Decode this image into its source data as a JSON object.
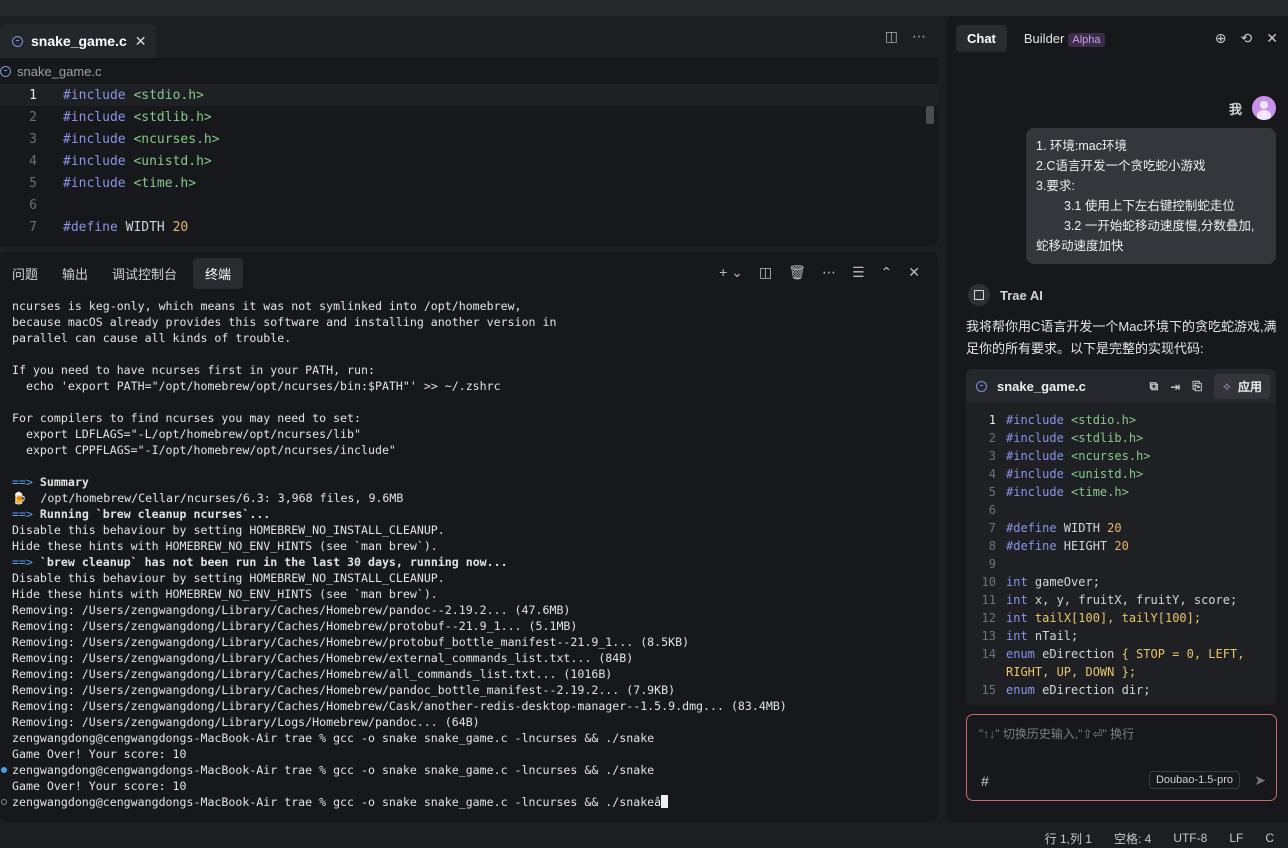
{
  "editor": {
    "tab_label": "snake_game.c",
    "breadcrumb": "snake_game.c",
    "lines": [
      {
        "n": "1",
        "pre": "#include",
        "arg": "<stdio.h>",
        "type": "include"
      },
      {
        "n": "2",
        "pre": "#include",
        "arg": "<stdlib.h>",
        "type": "include"
      },
      {
        "n": "3",
        "pre": "#include",
        "arg": "<ncurses.h>",
        "type": "include"
      },
      {
        "n": "4",
        "pre": "#include",
        "arg": "<unistd.h>",
        "type": "include"
      },
      {
        "n": "5",
        "pre": "#include",
        "arg": "<time.h>",
        "type": "include"
      },
      {
        "n": "6",
        "pre": "",
        "arg": "",
        "type": "blank"
      },
      {
        "n": "7",
        "pre": "#define",
        "arg": "WIDTH",
        "val": "20",
        "type": "define"
      }
    ]
  },
  "panel": {
    "tabs": [
      "问题",
      "输出",
      "调试控制台",
      "终端"
    ],
    "active_tab": "终端"
  },
  "terminal": {
    "lines": [
      {
        "t": "ncurses is keg-only, which means it was not symlinked into /opt/homebrew,"
      },
      {
        "t": "because macOS already provides this software and installing another version in"
      },
      {
        "t": "parallel can cause all kinds of trouble."
      },
      {
        "t": ""
      },
      {
        "t": "If you need to have ncurses first in your PATH, run:"
      },
      {
        "t": "  echo 'export PATH=\"/opt/homebrew/opt/ncurses/bin:$PATH\"' >> ~/.zshrc"
      },
      {
        "t": ""
      },
      {
        "t": "For compilers to find ncurses you may need to set:"
      },
      {
        "t": "  export LDFLAGS=\"-L/opt/homebrew/opt/ncurses/lib\""
      },
      {
        "t": "  export CPPFLAGS=\"-I/opt/homebrew/opt/ncurses/include\""
      },
      {
        "t": ""
      },
      {
        "arrow": "==>",
        "b": " Summary"
      },
      {
        "t": "🍺  /opt/homebrew/Cellar/ncurses/6.3: 3,968 files, 9.6MB"
      },
      {
        "arrow": "==>",
        "b": " Running `brew cleanup ncurses`..."
      },
      {
        "t": "Disable this behaviour by setting HOMEBREW_NO_INSTALL_CLEANUP."
      },
      {
        "t": "Hide these hints with HOMEBREW_NO_ENV_HINTS (see `man brew`)."
      },
      {
        "arrow": "==>",
        "b": " `brew cleanup` has not been run in the last 30 days, running now..."
      },
      {
        "t": "Disable this behaviour by setting HOMEBREW_NO_INSTALL_CLEANUP."
      },
      {
        "t": "Hide these hints with HOMEBREW_NO_ENV_HINTS (see `man brew`)."
      },
      {
        "t": "Removing: /Users/zengwangdong/Library/Caches/Homebrew/pandoc--2.19.2... (47.6MB)"
      },
      {
        "t": "Removing: /Users/zengwangdong/Library/Caches/Homebrew/protobuf--21.9_1... (5.1MB)"
      },
      {
        "t": "Removing: /Users/zengwangdong/Library/Caches/Homebrew/protobuf_bottle_manifest--21.9_1... (8.5KB)"
      },
      {
        "t": "Removing: /Users/zengwangdong/Library/Caches/Homebrew/external_commands_list.txt... (84B)"
      },
      {
        "t": "Removing: /Users/zengwangdong/Library/Caches/Homebrew/all_commands_list.txt... (1016B)"
      },
      {
        "t": "Removing: /Users/zengwangdong/Library/Caches/Homebrew/pandoc_bottle_manifest--2.19.2... (7.9KB)"
      },
      {
        "t": "Removing: /Users/zengwangdong/Library/Caches/Homebrew/Cask/another-redis-desktop-manager--1.5.9.dmg... (83.4MB)"
      },
      {
        "t": "Removing: /Users/zengwangdong/Library/Logs/Homebrew/pandoc... (64B)"
      },
      {
        "t": "zengwangdong@cengwangdongs-MacBook-Air trae % gcc -o snake snake_game.c -lncurses && ./snake"
      },
      {
        "t": "Game Over! Your score: 10"
      },
      {
        "t": "zengwangdong@cengwangdongs-MacBook-Air trae % gcc -o snake snake_game.c -lncurses && ./snake",
        "dot": "blue"
      },
      {
        "t": "Game Over! Your score: 10"
      },
      {
        "t": "zengwangdong@cengwangdongs-MacBook-Air trae % gcc -o snake snake_game.c -lncurses && ./snakeâ",
        "dot": "hollow",
        "cursor": true
      }
    ]
  },
  "chat": {
    "tab_chat": "Chat",
    "tab_builder": "Builder",
    "alpha_badge": "Alpha",
    "user_name": "我",
    "user_message": {
      "l1": "1. 环境:mac环境",
      "l2": "2.C语言开发一个贪吃蛇小游戏",
      "l3": "3.要求:",
      "l4": "3.1 使用上下左右键控制蛇走位",
      "l5": "3.2 一开始蛇移动速度慢,分数叠加,",
      "l6": "蛇移动速度加快"
    },
    "ai_name": "Trae AI",
    "ai_intro": "我将帮你用C语言开发一个Mac环境下的贪吃蛇游戏,满足你的所有要求。以下是完整的实现代码:",
    "code_card": {
      "filename": "snake_game.c",
      "apply_label": "应用",
      "lines": [
        {
          "n": "1",
          "kw": "#include",
          "rest": " ",
          "str": "<stdio.h>"
        },
        {
          "n": "2",
          "kw": "#include",
          "rest": " ",
          "str": "<stdlib.h>"
        },
        {
          "n": "3",
          "kw": "#include",
          "rest": " ",
          "str": "<ncurses.h>"
        },
        {
          "n": "4",
          "kw": "#include",
          "rest": " ",
          "str": "<unistd.h>"
        },
        {
          "n": "5",
          "kw": "#include",
          "rest": " ",
          "str": "<time.h>"
        },
        {
          "n": "6",
          "kw": "",
          "rest": "",
          "str": ""
        },
        {
          "n": "7",
          "kw": "#define",
          "rest": " WIDTH ",
          "num": "20"
        },
        {
          "n": "8",
          "kw": "#define",
          "rest": " HEIGHT ",
          "num": "20"
        },
        {
          "n": "9",
          "kw": "",
          "rest": "",
          "str": ""
        },
        {
          "n": "10",
          "kw": "int",
          "rest": " gameOver;"
        },
        {
          "n": "11",
          "kw": "int",
          "rest": " x, y, fruitX, fruitY, score;"
        },
        {
          "n": "12",
          "kw": "int",
          "rest": " ",
          "arr": "tailX[100], tailY[100];"
        },
        {
          "n": "13",
          "kw": "int",
          "rest": " nTail;"
        },
        {
          "n": "14",
          "kw": "enum",
          "rest": " eDirection ",
          "arr": "{ STOP = 0, LEFT, RIGHT, UP, DOWN };"
        },
        {
          "n": "15",
          "kw": "enum",
          "rest": " eDirection dir;"
        }
      ]
    },
    "input_placeholder": "\"↑↓\" 切换历史输入,\"⇧⏎\" 换行",
    "model_label": "Doubao-1.5-pro"
  },
  "status": {
    "position": "行 1,列 1",
    "spaces": "空格: 4",
    "encoding": "UTF-8",
    "eol": "LF",
    "lang": "C"
  }
}
